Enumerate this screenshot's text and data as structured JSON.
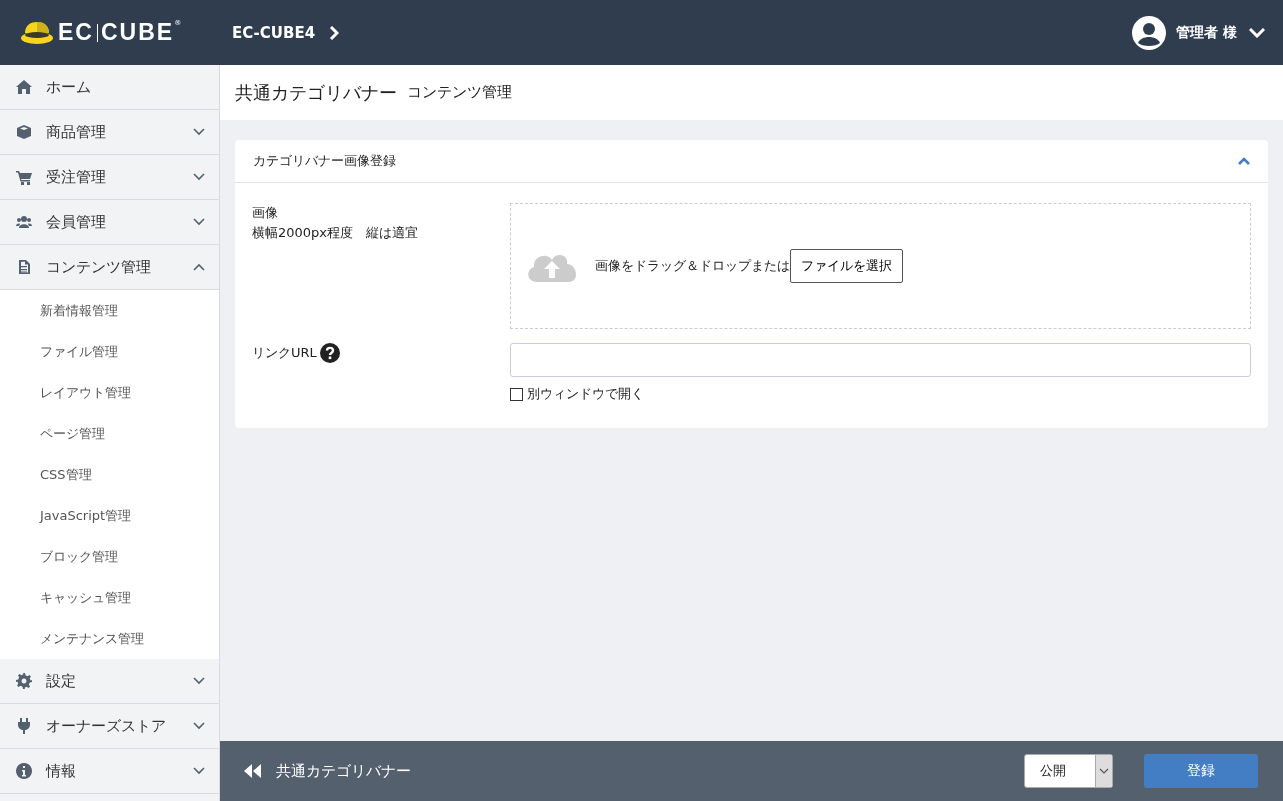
{
  "header": {
    "logo": {
      "left": "EC",
      "right": "CUBE",
      "mark": "®"
    },
    "site": "EC-CUBE4",
    "user": "管理者 様"
  },
  "sidebar": {
    "items": [
      {
        "label": "ホーム",
        "kind": "home"
      },
      {
        "label": "商品管理",
        "kind": "cube",
        "expanded": false
      },
      {
        "label": "受注管理",
        "kind": "cart",
        "expanded": false
      },
      {
        "label": "会員管理",
        "kind": "users",
        "expanded": false
      },
      {
        "label": "コンテンツ管理",
        "kind": "file",
        "expanded": true,
        "children": [
          {
            "label": "新着情報管理"
          },
          {
            "label": "ファイル管理"
          },
          {
            "label": "レイアウト管理"
          },
          {
            "label": "ページ管理"
          },
          {
            "label": "CSS管理"
          },
          {
            "label": "JavaScript管理"
          },
          {
            "label": "ブロック管理"
          },
          {
            "label": "キャッシュ管理"
          },
          {
            "label": "メンテナンス管理"
          }
        ]
      },
      {
        "label": "設定",
        "kind": "gear",
        "expanded": false
      },
      {
        "label": "オーナーズストア",
        "kind": "plug",
        "expanded": false
      },
      {
        "label": "情報",
        "kind": "info",
        "expanded": false
      }
    ]
  },
  "page": {
    "title": "共通カテゴリバナー",
    "subtitle": "コンテンツ管理"
  },
  "card": {
    "title": "カテゴリバナー画像登録",
    "expanded": true,
    "image": {
      "label": "画像",
      "hint": "横幅2000px程度　縦は適宜",
      "drop_text": "画像をドラッグ＆ドロップまたは",
      "button": "ファイルを選択"
    },
    "link": {
      "label": "リンクURL",
      "checkbox": {
        "label": "別ウィンドウで開く",
        "checked": false
      }
    }
  },
  "footer": {
    "back": "共通カテゴリバナー",
    "status": "公開",
    "submit": "登録"
  }
}
